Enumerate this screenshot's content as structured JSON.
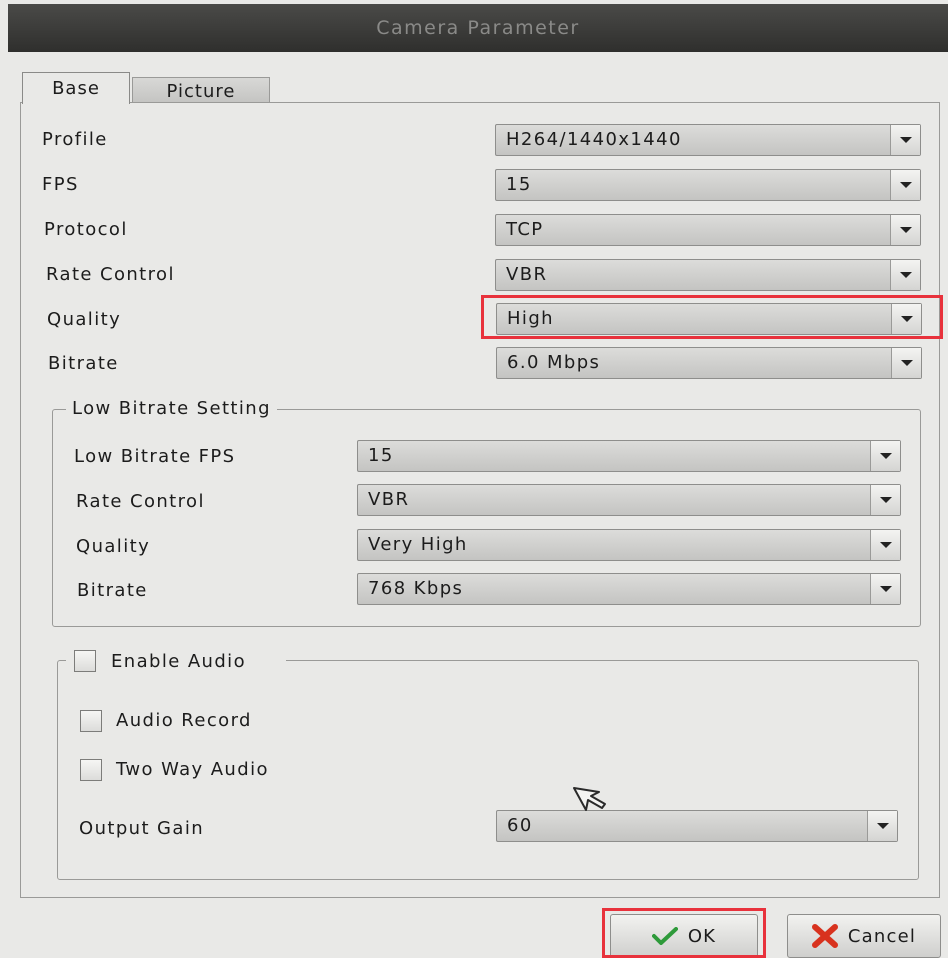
{
  "window": {
    "title": "Camera Parameter"
  },
  "tabs": [
    {
      "label": "Base",
      "active": true
    },
    {
      "label": "Picture",
      "active": false
    }
  ],
  "base": {
    "profile": {
      "label": "Profile",
      "value": "H264/1440x1440"
    },
    "fps": {
      "label": "FPS",
      "value": "15"
    },
    "protocol": {
      "label": "Protocol",
      "value": "TCP"
    },
    "rate_control": {
      "label": "Rate Control",
      "value": "VBR"
    },
    "quality": {
      "label": "Quality",
      "value": "High"
    },
    "bitrate": {
      "label": "Bitrate",
      "value": "6.0 Mbps"
    }
  },
  "low_bitrate": {
    "title": "Low Bitrate Setting",
    "fps": {
      "label": "Low Bitrate FPS",
      "value": "15"
    },
    "rate_control": {
      "label": "Rate Control",
      "value": "VBR"
    },
    "quality": {
      "label": "Quality",
      "value": "Very High"
    },
    "bitrate": {
      "label": "Bitrate",
      "value": "768 Kbps"
    }
  },
  "audio": {
    "enable_label": "Enable Audio",
    "enable_checked": false,
    "record_label": "Audio Record",
    "record_checked": false,
    "two_way_label": "Two Way Audio",
    "two_way_checked": false,
    "output_gain": {
      "label": "Output Gain",
      "value": "60"
    }
  },
  "buttons": {
    "ok": "OK",
    "cancel": "Cancel"
  },
  "colors": {
    "highlight": "#e8323c",
    "ok_check": "#2e9a3a",
    "cancel_x": "#d8321e",
    "titlebar": "#3a3a38"
  },
  "icons": [
    "dropdown-arrow-icon",
    "check-icon",
    "x-icon",
    "mouse-cursor-icon"
  ]
}
